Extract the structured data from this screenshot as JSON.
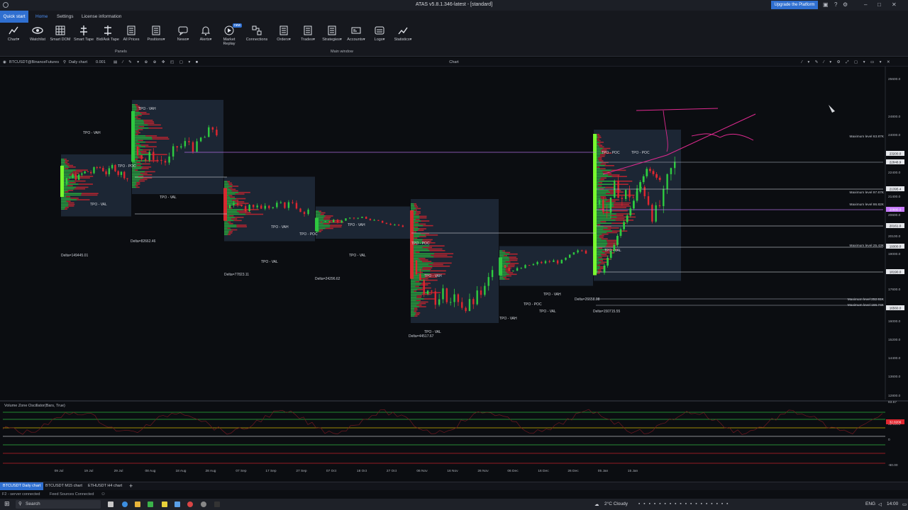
{
  "window": {
    "title": "ATAS v5.8.1.346-latest - [standard]",
    "upgrade_label": "Upgrade the Platform"
  },
  "menu": {
    "quick_start": "Quick start",
    "items": [
      "Home",
      "Settings",
      "License information"
    ]
  },
  "ribbon": {
    "buttons": [
      {
        "label": "Chart▾",
        "icon": "chart-icon"
      },
      {
        "label": "Watchlist",
        "icon": "eye-icon"
      },
      {
        "label": "Smart DOM",
        "icon": "dom-grid-icon"
      },
      {
        "label": "Smart Tape",
        "icon": "tape-icon"
      },
      {
        "label": "Bid/Ask Tape",
        "icon": "bid-ask-icon"
      },
      {
        "label": "All Prices",
        "icon": "prices-icon"
      },
      {
        "label": "Positions▾",
        "icon": "positions-icon"
      },
      {
        "label": "News▾",
        "icon": "news-icon"
      },
      {
        "label": "Alerts▾",
        "icon": "bell-icon"
      },
      {
        "label": "Market Replay",
        "icon": "replay-icon"
      },
      {
        "label": "Connections",
        "icon": "connections-icon"
      },
      {
        "label": "Orders▾",
        "icon": "orders-icon"
      },
      {
        "label": "Trades▾",
        "icon": "trades-icon"
      },
      {
        "label": "Strategies▾",
        "icon": "strategies-icon"
      },
      {
        "label": "Accounts▾",
        "icon": "accounts-icon"
      },
      {
        "label": "Logs▾",
        "icon": "logs-icon"
      },
      {
        "label": "Statistics▾",
        "icon": "statistics-icon"
      }
    ],
    "new_badge": "new",
    "group_panels": "Panels",
    "group_main": "Main window"
  },
  "chart_header": {
    "instrument": "BTCUSDT@BinanceFutures",
    "timeframe": "Daily chart",
    "tick": "0.001",
    "title": "Chart"
  },
  "chart_data": {
    "type": "candlestick-market-profile",
    "price_axis": [
      "25600.0",
      "24800.0",
      "24000.0",
      "23300.0",
      "22400.0",
      "21400.0",
      "20600.0",
      "20100.0",
      "19000.0",
      "18400.0",
      "17600.0",
      "16800.0",
      "16000.0",
      "15200.0",
      "14400.0",
      "13600.0",
      "12800.0"
    ],
    "price_markers": [
      {
        "label": "23200.0",
        "highlight": false
      },
      {
        "label": "22848.9",
        "highlight": false
      },
      {
        "label": "21395.4",
        "highlight": false
      },
      {
        "label": "20880.0",
        "highlight": true
      },
      {
        "label": "20161.0",
        "highlight": false
      },
      {
        "label": "19300.0",
        "highlight": false
      },
      {
        "label": "18190.0",
        "highlight": false
      },
      {
        "label": "16560.0",
        "highlight": false
      }
    ],
    "profile_labels": [
      "TPO - VAH",
      "TPO - VAL",
      "TPO - POC",
      "Delta=149445.01",
      "TPO - VAH",
      "TPO - VAL",
      "Delta=82662.46",
      "TPO - VAH",
      "TPO - VAL",
      "Delta=77823.11",
      "TPO - VAH",
      "TPO - VAL",
      "TPO - POC",
      "Delta=24296.62",
      "TPO - POC",
      "TPO - VAH",
      "TPO - VAL",
      "Delta=44517.67",
      "TPO - VAH",
      "TPO - POC",
      "TPO - VAL",
      "Delta=26658.08",
      "TPO - VAH",
      "TPO - POC",
      "TPO - VAL",
      "TPO - POC",
      "Delta=150715.55"
    ],
    "maximum_level_labels": [
      "Maximum level 63.87K",
      "Maximum level 97.67K",
      "Maximum level 86.82K",
      "Maximum level 25.43K",
      "Maximum level 252.61K",
      "Maximum level 166.74K"
    ],
    "x_ticks": [
      "09 Jul",
      "19 Jul",
      "29 Jul",
      "08 Aug",
      "18 Aug",
      "28 Aug",
      "07 Sep",
      "17 Sep",
      "27 Sep",
      "07 Oct",
      "18 Oct",
      "27 Oct",
      "06 Nov",
      "16 Nov",
      "26 Nov",
      "06 Dec",
      "16 Dec",
      "26 Dec",
      "05 Jan",
      "15 Jan"
    ],
    "indicator": {
      "name": "Volume Zone Oscillator(Bars, True)",
      "axis": [
        "83.67",
        "32.8206",
        "0",
        "-60.00"
      ],
      "current_value": "32.8206"
    }
  },
  "tabs": [
    "BTCUSDT Daily chart",
    "BTCUSDT M15 chart",
    "ETHUSDT H4 chart"
  ],
  "add_tab": "+",
  "status": {
    "server": "F2 - server connected",
    "feed": "Feed Sources Connected"
  },
  "taskbar": {
    "search_placeholder": "Search",
    "weather": "2°C  Cloudy",
    "lang": "ENG",
    "time": "14:00"
  },
  "colors": {
    "accent": "#2f6fd0",
    "bull": "#2ecc40",
    "bear": "#e0262f",
    "profile_bg": "#233243",
    "annotation": "#e02a90"
  }
}
